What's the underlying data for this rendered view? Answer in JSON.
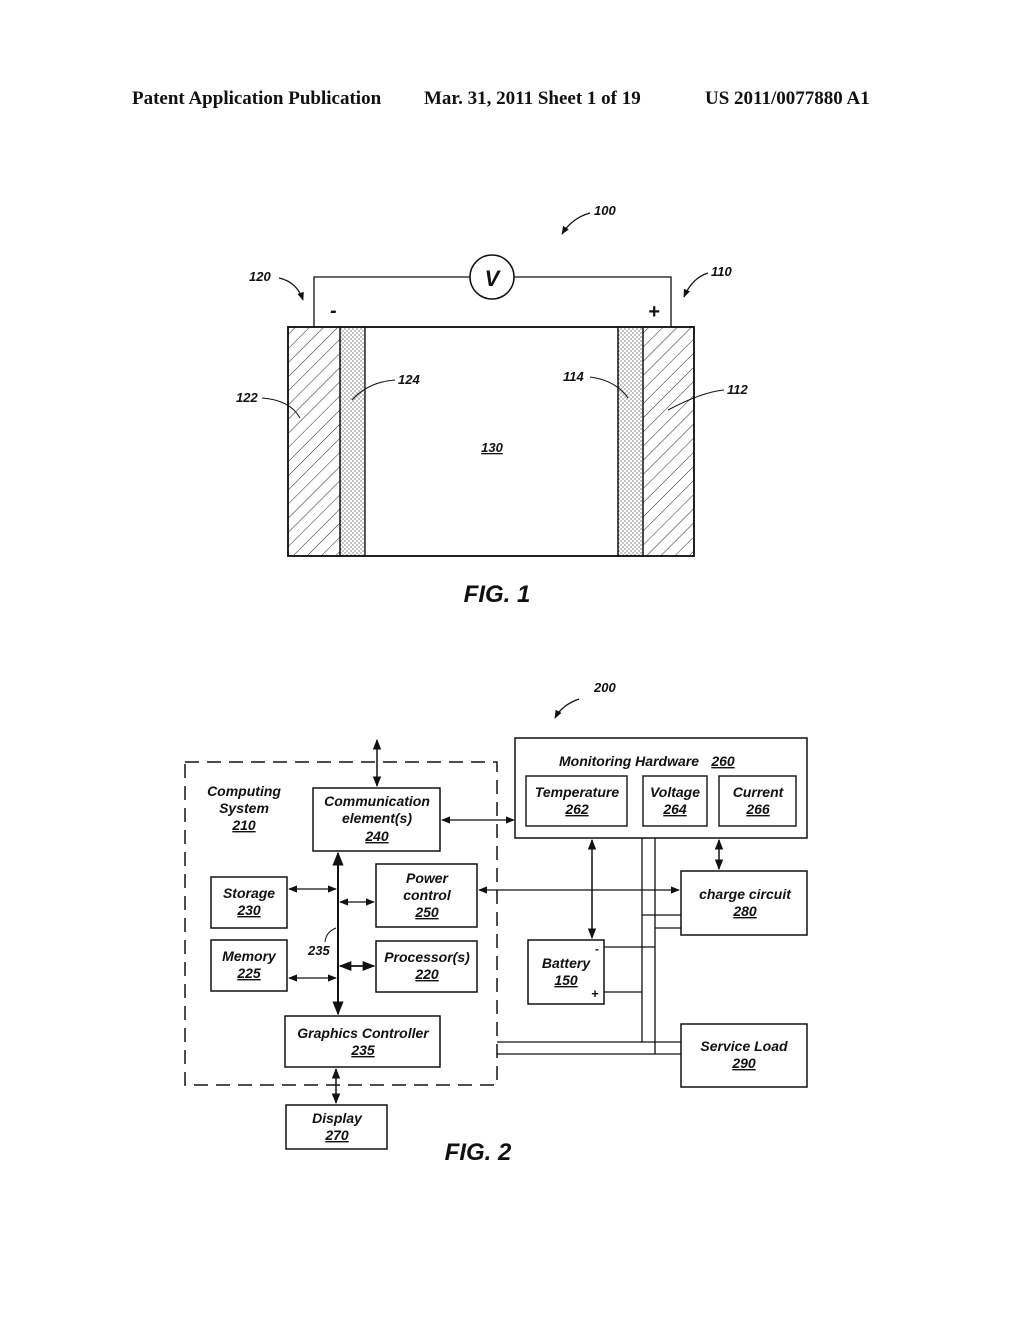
{
  "header": {
    "publication": "Patent Application Publication",
    "date_sheet": "Mar. 31, 2011  Sheet 1 of 19",
    "number": "US 2011/0077880 A1"
  },
  "fig1": {
    "caption": "FIG. 1",
    "ref_system": "100",
    "ref_positive": "110",
    "ref_negative": "120",
    "ref_pos_current_collector": "112",
    "ref_pos_electrode": "114",
    "ref_neg_current_collector": "122",
    "ref_neg_electrode": "124",
    "ref_electrolyte": "130",
    "voltmeter": "V",
    "minus": "-",
    "plus": "+"
  },
  "fig2": {
    "caption": "FIG. 2",
    "ref_system": "200",
    "bus_ref": "235",
    "computing_system": {
      "line1": "Computing",
      "line2": "System",
      "ref": "210"
    },
    "communication": {
      "line1": "Communication",
      "line2": "element(s)",
      "ref": "240"
    },
    "storage": {
      "label": "Storage",
      "ref": "230"
    },
    "memory": {
      "label": "Memory",
      "ref": "225"
    },
    "power_control": {
      "line1": "Power",
      "line2": "control",
      "ref": "250"
    },
    "processor": {
      "label": "Processor(s)",
      "ref": "220"
    },
    "graphics": {
      "label": "Graphics Controller",
      "ref": "235"
    },
    "display": {
      "label": "Display",
      "ref": "270"
    },
    "monitoring": {
      "label": "Monitoring Hardware",
      "ref": "260"
    },
    "temperature": {
      "label": "Temperature",
      "ref": "262"
    },
    "voltage": {
      "label": "Voltage",
      "ref": "264"
    },
    "current": {
      "label": "Current",
      "ref": "266"
    },
    "charge": {
      "label": "charge circuit",
      "ref": "280"
    },
    "battery": {
      "label": "Battery",
      "ref": "150",
      "minus": "-",
      "plus": "+"
    },
    "service_load": {
      "label": "Service Load",
      "ref": "290"
    }
  }
}
